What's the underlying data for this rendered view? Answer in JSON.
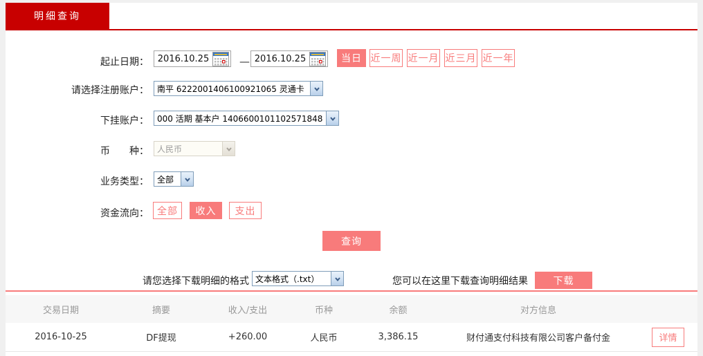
{
  "colors": {
    "brand_red": "#c80000",
    "accent_salmon": "#f87b7b",
    "amount_red": "#d40000"
  },
  "tab": {
    "label": "明细查询"
  },
  "form": {
    "date_range": {
      "label": "起止日期：",
      "start": "2016.10.25",
      "separator": "—",
      "end": "2016.10.25",
      "quick_buttons": [
        {
          "label": "当日",
          "active": true
        },
        {
          "label": "近一周",
          "active": false
        },
        {
          "label": "近一月",
          "active": false
        },
        {
          "label": "近三月",
          "active": false
        },
        {
          "label": "近一年",
          "active": false
        }
      ]
    },
    "register_account": {
      "label": "请选择注册账户：",
      "value": "南平 6222001406100921065 灵通卡"
    },
    "sub_account": {
      "label": "下挂账户：",
      "value": "000 活期 基本户 1406600101102571848"
    },
    "currency": {
      "label": "币　　种：",
      "value": "人民币",
      "disabled": true
    },
    "business_type": {
      "label": "业务类型：",
      "value": "全部"
    },
    "fund_direction": {
      "label": "资金流向：",
      "options": [
        {
          "label": "全部",
          "active": false
        },
        {
          "label": "收入",
          "active": true
        },
        {
          "label": "支出",
          "active": false
        }
      ]
    },
    "query_button_label": "查询"
  },
  "download": {
    "format_label": "请您选择下载明细的格式",
    "format_value": "文本格式（.txt）",
    "hint": "您可以在这里下载查询明细结果",
    "button_label": "下载"
  },
  "table": {
    "headers": [
      "交易日期",
      "摘要",
      "收入/支出",
      "币种",
      "余额",
      "对方信息"
    ],
    "rows": [
      {
        "date": "2016-10-25",
        "summary": "DF提现",
        "amount": "+260.00",
        "currency": "人民币",
        "balance": "3,386.15",
        "counterparty": "财付通支付科技有限公司客户备付金",
        "action_label": "详情"
      }
    ]
  }
}
